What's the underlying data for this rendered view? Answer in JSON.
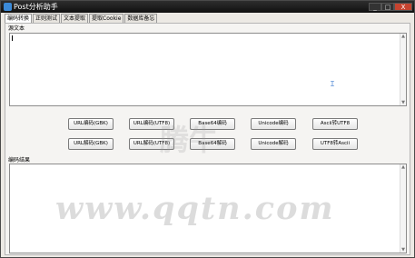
{
  "window": {
    "title": "Post分析助手",
    "controls": {
      "minimize": "_",
      "maximize": "□",
      "close": "X"
    }
  },
  "tabs": [
    {
      "label": "编码转换",
      "active": true
    },
    {
      "label": "正则测试",
      "active": false
    },
    {
      "label": "文本提取",
      "active": false
    },
    {
      "label": "提取Cookie",
      "active": false
    },
    {
      "label": "数据库备忘",
      "active": false
    }
  ],
  "source": {
    "label": "源文本",
    "value": ""
  },
  "buttons_row1": [
    {
      "label": "URL编码(GBK)"
    },
    {
      "label": "URL编码(UTF8)"
    },
    {
      "label": "Base64编码"
    },
    {
      "label": "Unicode编码"
    },
    {
      "label": "Ascii转UTF8"
    }
  ],
  "buttons_row2": [
    {
      "label": "URL解码(GBK)"
    },
    {
      "label": "URL解码(UTF8)"
    },
    {
      "label": "Base64解码"
    },
    {
      "label": "Unicode解码"
    },
    {
      "label": "UTF8转Ascii"
    }
  ],
  "result": {
    "label": "编码结果",
    "value": ""
  },
  "watermark": "www.qqtn.com",
  "watermark_center": "腾牛"
}
